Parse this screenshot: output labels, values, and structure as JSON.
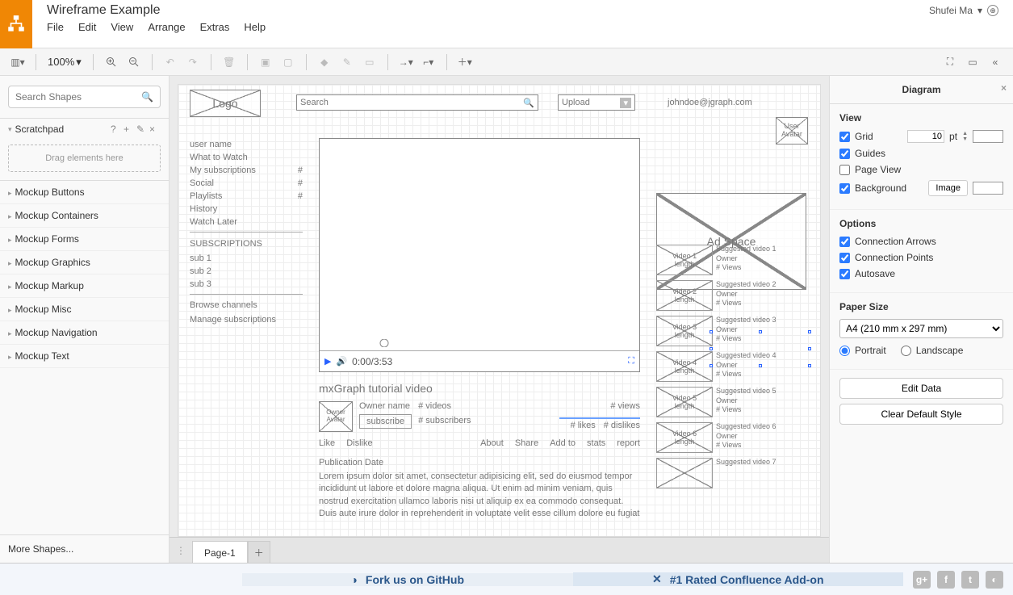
{
  "header": {
    "title": "Wireframe Example",
    "user": "Shufei Ma",
    "menu": [
      "File",
      "Edit",
      "View",
      "Arrange",
      "Extras",
      "Help"
    ]
  },
  "toolbar": {
    "zoom": "100%"
  },
  "leftPanel": {
    "searchPlaceholder": "Search Shapes",
    "scratchpad": "Scratchpad",
    "dragHint": "Drag elements here",
    "groups": [
      "Mockup Buttons",
      "Mockup Containers",
      "Mockup Forms",
      "Mockup Graphics",
      "Mockup Markup",
      "Mockup Misc",
      "Mockup Navigation",
      "Mockup Text"
    ],
    "more": "More Shapes..."
  },
  "canvas": {
    "logo": "Logo",
    "searchPlaceholder": "Search",
    "upload": "Upload",
    "email": "johndoe@jgraph.com",
    "userAvatar": "User Avatar",
    "nav": [
      {
        "label": "user name",
        "badge": ""
      },
      {
        "label": "What to Watch",
        "badge": ""
      },
      {
        "label": "My subscriptions",
        "badge": "#"
      },
      {
        "label": "Social",
        "badge": "#"
      },
      {
        "label": "Playlists",
        "badge": "#"
      },
      {
        "label": "History",
        "badge": ""
      },
      {
        "label": "Watch Later",
        "badge": ""
      }
    ],
    "subsHeader": "SUBSCRIPTIONS",
    "subs": [
      "sub 1",
      "sub 2",
      "sub 3"
    ],
    "browse": "Browse channels",
    "manage": "Manage subscriptions",
    "video": {
      "time": "0:00/3:53",
      "title": "mxGraph tutorial video"
    },
    "owner": {
      "avatar": "Owner Avatar",
      "name": "Owner name",
      "videos": "# videos",
      "subscribers": "# subscribers",
      "subscribe": "subscribe"
    },
    "stats": {
      "views": "# views",
      "likes": "# likes",
      "dislikes": "# dislikes"
    },
    "actions": {
      "like": "Like",
      "dislike": "Dislike",
      "about": "About",
      "share": "Share",
      "addto": "Add to",
      "stats": "stats",
      "report": "report"
    },
    "pubDate": "Publication Date",
    "lorem": "Lorem ipsum dolor sit amet, consectetur adipisicing elit, sed do eiusmod tempor incididunt ut labore et dolore magna aliqua. Ut enim ad minim veniam, quis nostrud exercitation ullamco laboris nisi ut aliquip ex ea commodo consequat. Duis aute irure dolor in reprehenderit in voluptate velit esse cillum dolore eu fugiat",
    "adSpace": "Ad Space",
    "suggested": [
      {
        "thumb": "Video 1",
        "len": "length",
        "title": "Suggested video 1",
        "owner": "Owner",
        "views": "# Views"
      },
      {
        "thumb": "Video 2",
        "len": "length",
        "title": "Suggested video 2",
        "owner": "Owner",
        "views": "# Views"
      },
      {
        "thumb": "Video 3",
        "len": "length",
        "title": "Suggested video 3",
        "owner": "Owner",
        "views": "# Views"
      },
      {
        "thumb": "Video 4",
        "len": "length",
        "title": "Suggested video 4",
        "owner": "Owner",
        "views": "# Views"
      },
      {
        "thumb": "Video 5",
        "len": "length",
        "title": "Suggested video 5",
        "owner": "Owner",
        "views": "# Views"
      },
      {
        "thumb": "Video 6",
        "len": "length",
        "title": "Suggested video 6",
        "owner": "Owner",
        "views": "# Views"
      },
      {
        "thumb": "",
        "len": "",
        "title": "Suggested video 7",
        "owner": "",
        "views": ""
      }
    ]
  },
  "pageTabs": {
    "tab": "Page-1"
  },
  "rightPanel": {
    "title": "Diagram",
    "view": {
      "title": "View",
      "grid": "Grid",
      "gridSize": "10",
      "gridUnit": "pt",
      "guides": "Guides",
      "pageView": "Page View",
      "background": "Background",
      "imageBtn": "Image"
    },
    "options": {
      "title": "Options",
      "connArrows": "Connection Arrows",
      "connPoints": "Connection Points",
      "autosave": "Autosave"
    },
    "paper": {
      "title": "Paper Size",
      "size": "A4 (210 mm x 297 mm)",
      "portrait": "Portrait",
      "landscape": "Landscape"
    },
    "actions": {
      "edit": "Edit Data",
      "clear": "Clear Default Style"
    }
  },
  "footer": {
    "fork": "Fork us on GitHub",
    "confluence": "#1 Rated Confluence Add-on"
  }
}
